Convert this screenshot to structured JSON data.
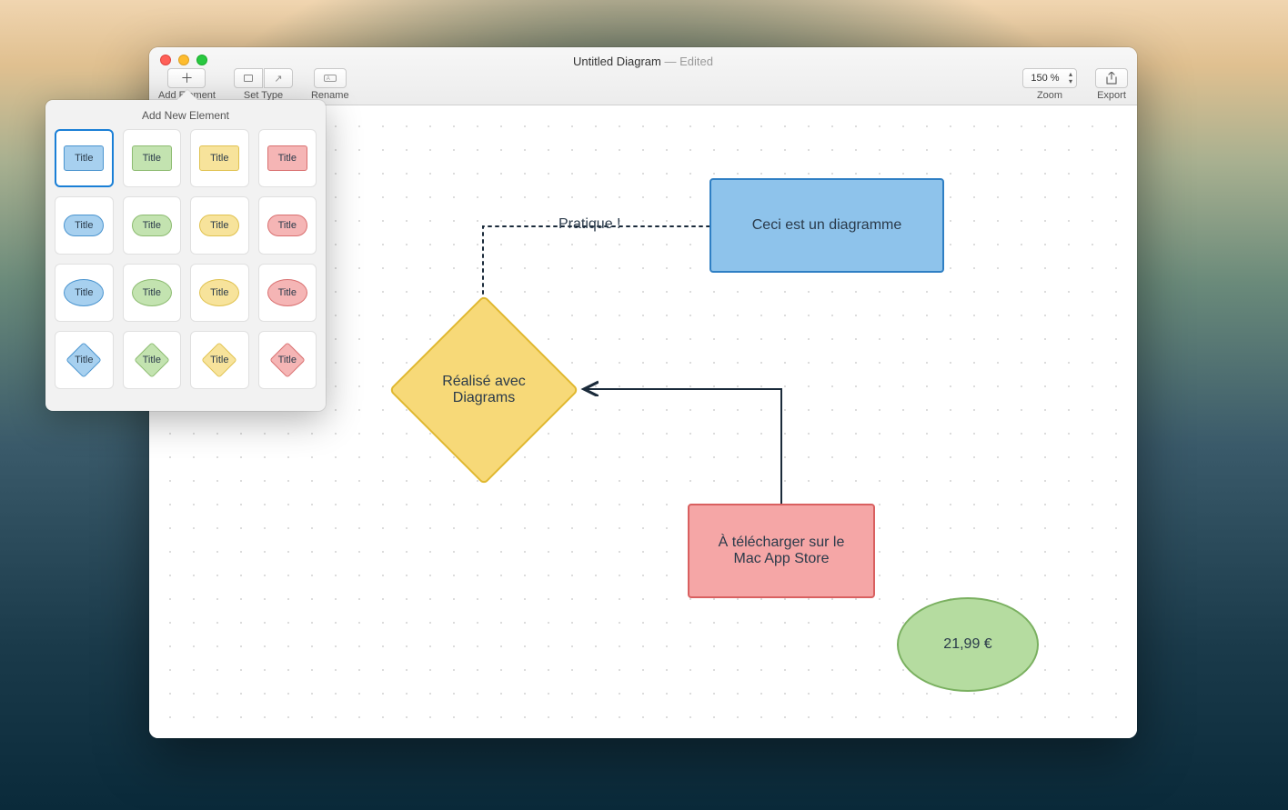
{
  "window": {
    "title": "Untitled Diagram",
    "subtitle": " — Edited"
  },
  "toolbar": {
    "add_element": "Add Element",
    "set_type": "Set Type",
    "rename": "Rename",
    "zoom_value": "150 %",
    "zoom_label": "Zoom",
    "export": "Export"
  },
  "popover": {
    "title": "Add New Element",
    "cell_label": "Title"
  },
  "diagram": {
    "node_blue": "Ceci est un diagramme",
    "node_diamond": "Réalisé avec Diagrams",
    "node_red": "À télécharger sur le Mac App Store",
    "node_ellipse": "21,99 €",
    "edge_label": "Pratique !"
  }
}
